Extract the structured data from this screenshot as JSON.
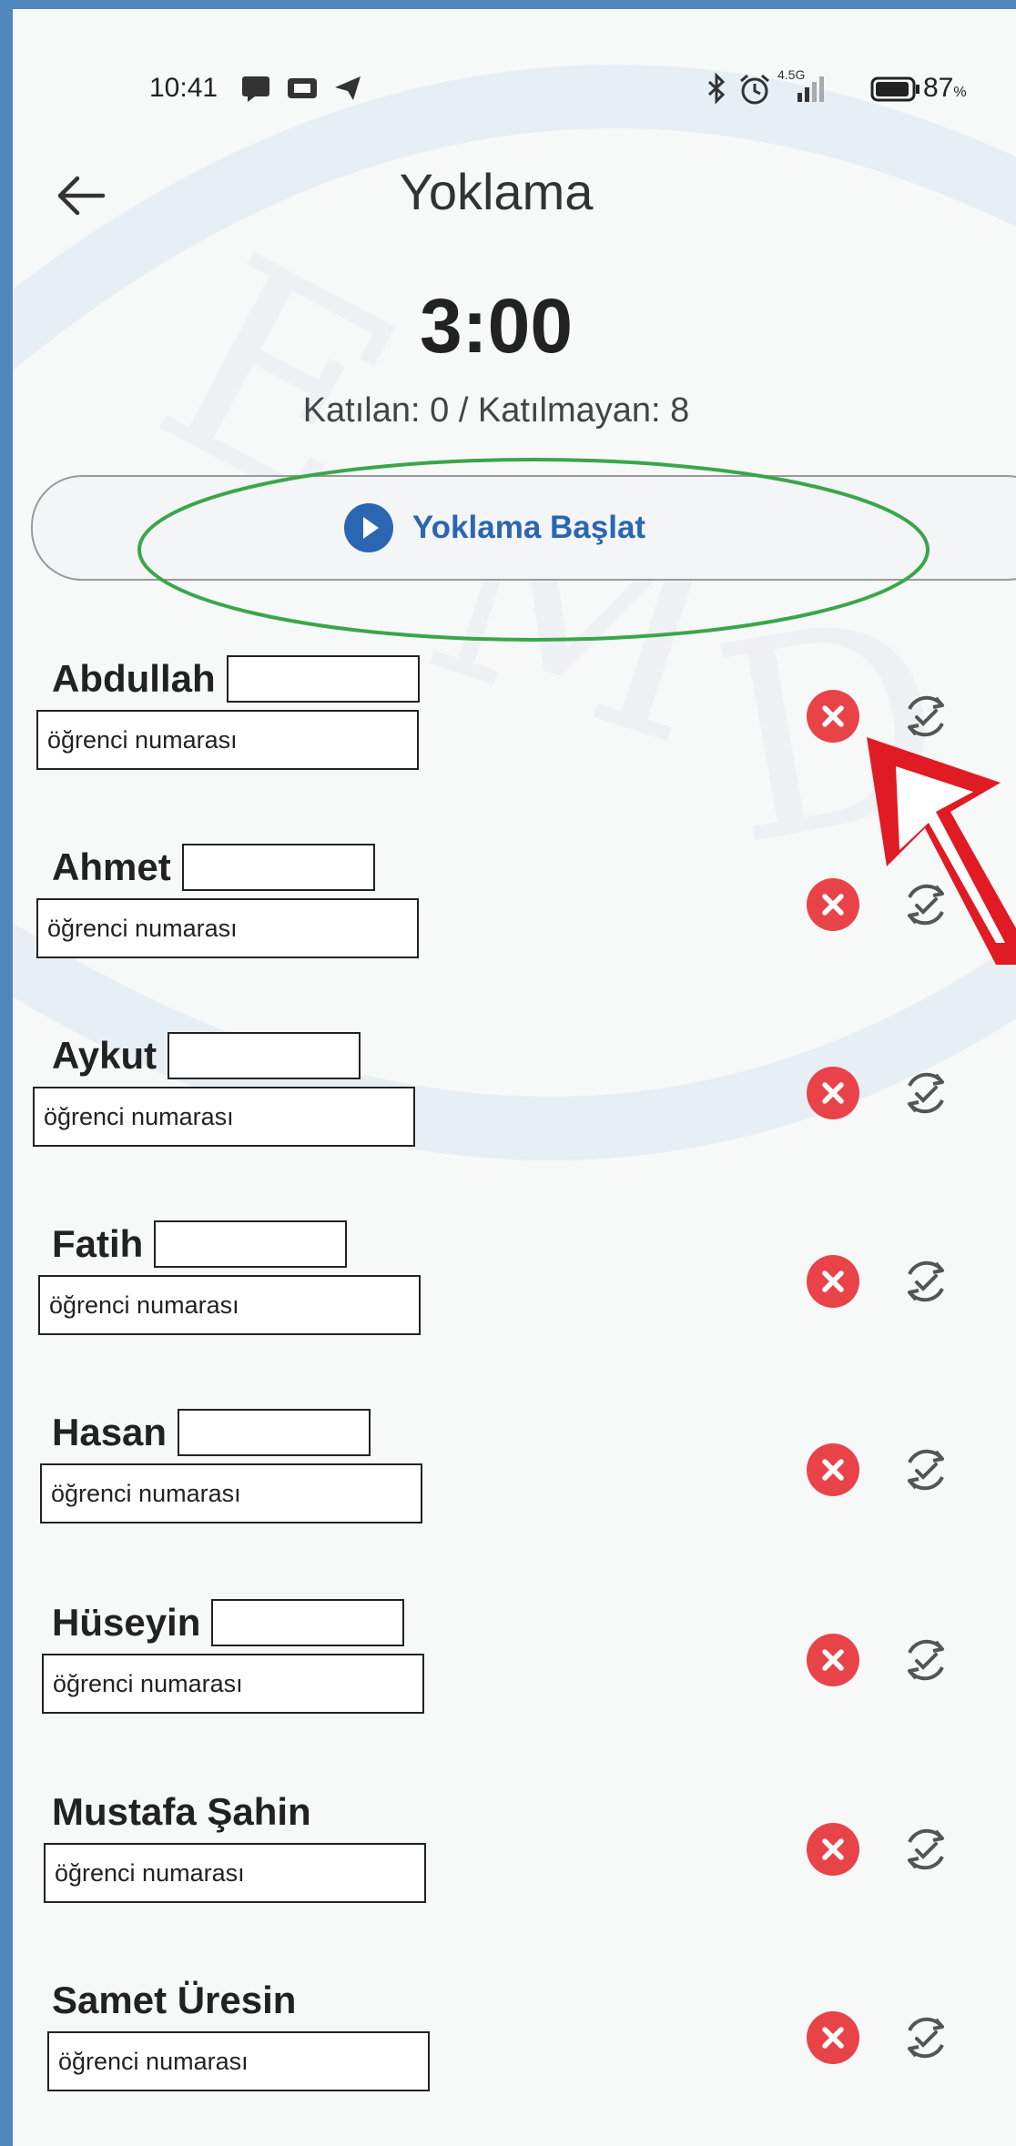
{
  "status_bar": {
    "time": "10:41",
    "battery": "87",
    "network": "4.5G",
    "icons": [
      "message-icon",
      "tv-icon",
      "send-icon",
      "bluetooth-icon",
      "alarm-icon",
      "signal-icon",
      "battery-icon"
    ]
  },
  "header": {
    "title": "Yoklama",
    "back_icon": "arrow-left-icon"
  },
  "attendance": {
    "timer": "3:00",
    "counts": "Katılan: 0 / Katılmayan: 8",
    "start_button": "Yoklama Başlat",
    "start_icon": "play-circle-icon"
  },
  "students": [
    {
      "name": "Abdullah",
      "has_name_box": true,
      "placeholder": "öğrenci numarası"
    },
    {
      "name": "Ahmet",
      "has_name_box": true,
      "placeholder": "öğrenci numarası"
    },
    {
      "name": "Aykut",
      "has_name_box": true,
      "placeholder": "öğrenci numarası"
    },
    {
      "name": "Fatih",
      "has_name_box": true,
      "placeholder": "öğrenci numarası"
    },
    {
      "name": "Hasan",
      "has_name_box": true,
      "placeholder": "öğrenci numarası"
    },
    {
      "name": "Hüseyin",
      "has_name_box": true,
      "placeholder": "öğrenci numarası"
    },
    {
      "name": "Mustafa Şahin",
      "has_name_box": false,
      "placeholder": "öğrenci numarası"
    },
    {
      "name": "Samet Üresin",
      "has_name_box": false,
      "placeholder": "öğrenci numarası"
    }
  ],
  "row_icons": {
    "absent": "close-circle-icon",
    "toggle": "sync-check-icon"
  },
  "colors": {
    "accent": "#2a66b1",
    "absent_red": "#e9434a",
    "annotation_green": "#3aa64a",
    "annotation_red": "#e01b24",
    "frame_blue": "#4f86bb"
  }
}
